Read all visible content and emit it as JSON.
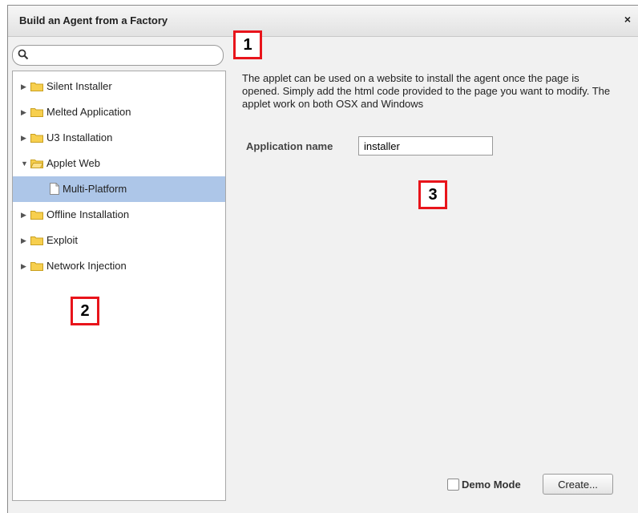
{
  "dialog": {
    "title": "Build an Agent from a Factory",
    "close_glyph": "×"
  },
  "search": {
    "value": "",
    "icon": "search-icon"
  },
  "tree": {
    "items": [
      {
        "label": "Silent Installer",
        "type": "folder",
        "expanded": false
      },
      {
        "label": "Melted Application",
        "type": "folder",
        "expanded": false
      },
      {
        "label": "U3 Installation",
        "type": "folder",
        "expanded": false
      },
      {
        "label": "Applet Web",
        "type": "folder",
        "expanded": true
      },
      {
        "label": "Multi-Platform",
        "type": "file",
        "selected": true
      },
      {
        "label": "Offline Installation",
        "type": "folder",
        "expanded": false
      },
      {
        "label": "Exploit",
        "type": "folder",
        "expanded": false
      },
      {
        "label": "Network Injection",
        "type": "folder",
        "expanded": false
      }
    ]
  },
  "panel": {
    "description": "The applet can be used on a website to install the agent once the page is opened. Simply add the html code provided to the page you want to modify. The applet work on both OSX and Windows",
    "app_name_label": "Application name",
    "app_name_value": "installer"
  },
  "footer": {
    "demo_mode_label": "Demo Mode",
    "demo_mode_checked": false,
    "create_label": "Create..."
  },
  "callouts": [
    "1",
    "2",
    "3"
  ],
  "colors": {
    "selection": "#adc6e8",
    "callout_border": "#e8141b",
    "folder": "#f7cf4e"
  }
}
